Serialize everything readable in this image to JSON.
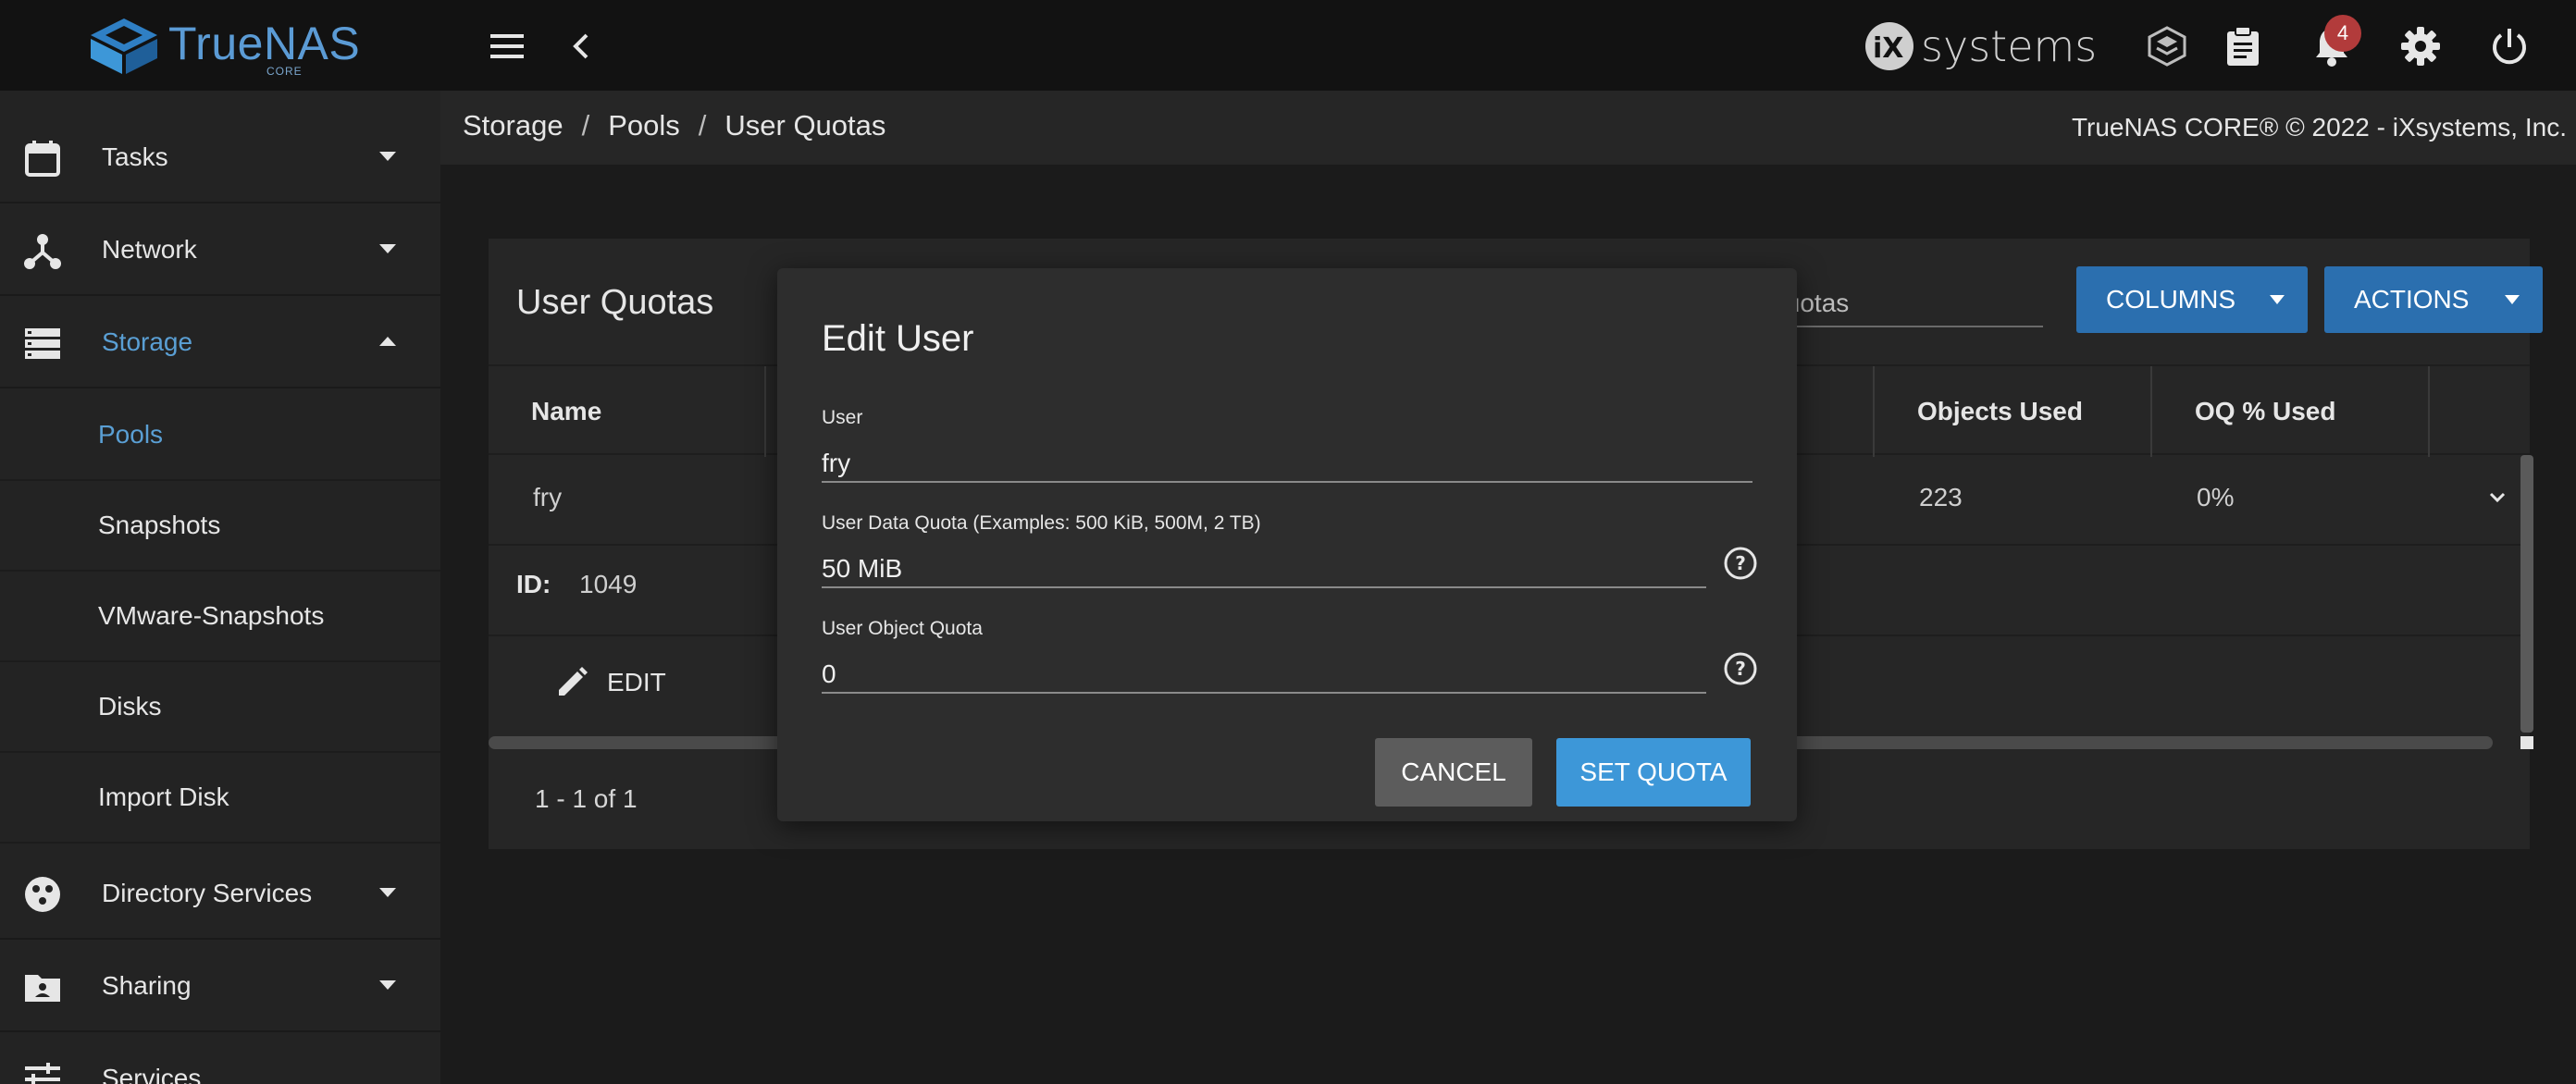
{
  "header": {
    "brand_name": "TrueNAS",
    "brand_edition": "CORE",
    "vendor_logo_text": "systems",
    "notification_count": "4"
  },
  "sidebar": {
    "items": [
      {
        "label": "Tasks",
        "icon": "calendar-icon"
      },
      {
        "label": "Network",
        "icon": "network-icon"
      },
      {
        "label": "Storage",
        "icon": "storage-icon",
        "expanded": true
      },
      {
        "label": "Directory Services",
        "icon": "directory-services-icon"
      },
      {
        "label": "Sharing",
        "icon": "sharing-icon"
      },
      {
        "label": "Services",
        "icon": "services-icon"
      }
    ],
    "storage_sub": [
      "Pools",
      "Snapshots",
      "VMware-Snapshots",
      "Disks",
      "Import Disk"
    ]
  },
  "breadcrumb": {
    "items": [
      "Storage",
      "Pools",
      "User Quotas"
    ],
    "separator": "/"
  },
  "copyright": "TrueNAS CORE® © 2022 - iXsystems, Inc.",
  "card": {
    "title": "User Quotas",
    "filter_text": "Quotas",
    "columns_button": "COLUMNS",
    "actions_button": "ACTIONS",
    "headers": {
      "name": "Name",
      "objects_used": "Objects Used",
      "oq_used": "OQ % Used"
    },
    "row": {
      "name": "fry",
      "objects_used": "223",
      "oq_used": "0%"
    },
    "detail": {
      "id_label": "ID:",
      "id_value": "1049",
      "edit_label": "EDIT"
    },
    "pager": "1 - 1 of 1"
  },
  "dialog": {
    "title": "Edit User",
    "user_label": "User",
    "user_value": "fry",
    "data_quota_label": "User Data Quota (Examples: 500 KiB, 500M, 2 TB)",
    "data_quota_value": "50 MiB",
    "object_quota_label": "User Object Quota",
    "object_quota_value": "0",
    "cancel_label": "CANCEL",
    "submit_label": "SET QUOTA"
  },
  "colors": {
    "accent": "#3d97d8",
    "button_blue": "#2b6faf",
    "badge_red": "#b23b3b",
    "active_nav": "#5a9fd4"
  }
}
